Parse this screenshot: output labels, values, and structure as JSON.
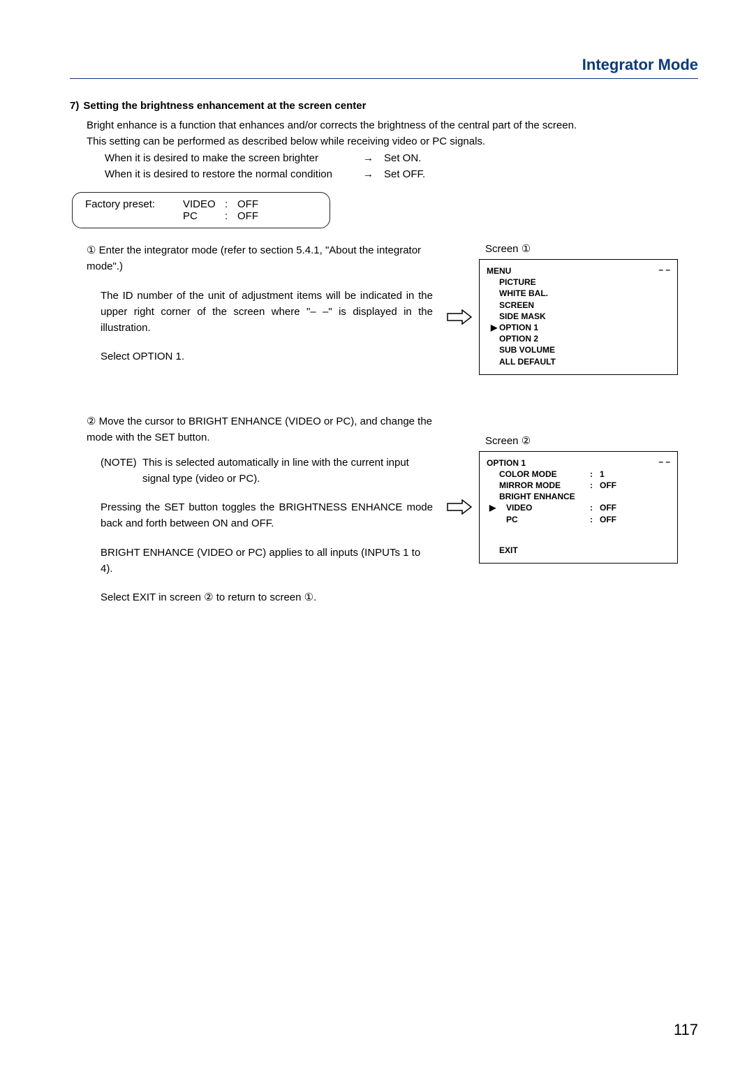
{
  "header": {
    "title": "Integrator Mode"
  },
  "section": {
    "num": "7)",
    "title": "Setting the brightness enhancement at the screen center",
    "intro1": "Bright enhance is a function that enhances and/or corrects the brightness of the central part of the screen.",
    "intro2": "This setting can be performed as described below while receiving video or PC signals.",
    "set_on_lhs": "When it is desired to make the screen brighter",
    "set_on_arrow": "→",
    "set_on_rhs": "Set ON.",
    "set_off_lhs": "When it is desired to restore the normal condition",
    "set_off_arrow": "→",
    "set_off_rhs": "Set OFF."
  },
  "preset": {
    "label": "Factory preset:",
    "k1": "VIDEO",
    "c": ":",
    "v1": "OFF",
    "k2": "PC",
    "v2": "OFF"
  },
  "step1": {
    "marker": "①",
    "text": "Enter the integrator mode (refer to section 5.4.1, \"About the integrator mode\".)",
    "para1": "The ID number of the unit of adjustment items will be indicated in the upper right corner of the screen where \"– –\" is displayed in the illustration.",
    "para2": "Select OPTION 1."
  },
  "step2": {
    "marker": "②",
    "text": "Move the cursor to BRIGHT ENHANCE (VIDEO or PC), and change the mode with the SET button.",
    "note_label": "(NOTE)",
    "note_text": "This is selected automatically in line with the current input signal type (video or PC).",
    "para1": "Pressing the SET button toggles the BRIGHTNESS ENHANCE mode back and forth between ON and OFF.",
    "para2": "BRIGHT ENHANCE (VIDEO or PC) applies to all inputs (INPUTs 1 to 4).",
    "para3": "Select EXIT in screen ② to return to screen ①."
  },
  "screen1": {
    "label": "Screen ①",
    "title": "MENU",
    "dd": "– –",
    "items": [
      "PICTURE",
      "WHITE BAL.",
      "SCREEN",
      "SIDE MASK",
      "OPTION 1",
      "OPTION 2",
      "SUB VOLUME",
      "ALL DEFAULT"
    ],
    "cursor_index": 4,
    "cursor_glyph": "▶"
  },
  "screen2": {
    "label": "Screen ②",
    "title": "OPTION 1",
    "dd": "– –",
    "rows": [
      {
        "key": "COLOR MODE",
        "val": "1"
      },
      {
        "key": "MIRROR MODE",
        "val": "OFF"
      },
      {
        "key": "BRIGHT ENHANCE",
        "val": ""
      }
    ],
    "subrows": [
      {
        "key": "VIDEO",
        "val": "OFF",
        "cursor": true
      },
      {
        "key": "PC",
        "val": "OFF",
        "cursor": false
      }
    ],
    "cursor_glyph": "▶",
    "colon": ":",
    "exit": "EXIT"
  },
  "page": "117"
}
